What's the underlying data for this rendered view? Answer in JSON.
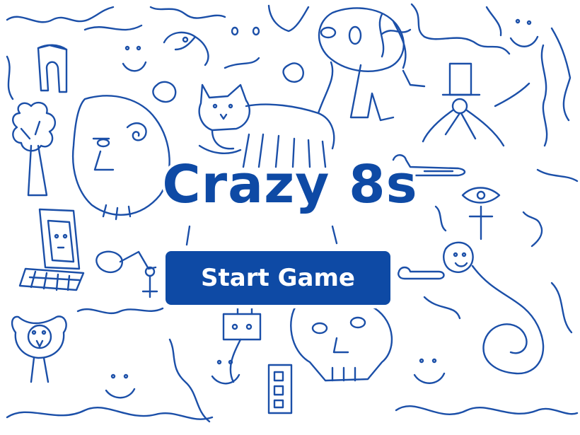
{
  "game": {
    "title": "Crazy 8s",
    "start_label": "Start Game"
  },
  "colors": {
    "ink": "#1b4fa8",
    "title": "#0e4aa5",
    "button": "#0e4aa5",
    "button_text": "#ffffff",
    "background": "#ffffff"
  },
  "background_art": {
    "style": "hand-drawn blue doodles",
    "doodles": [
      "face-ghost",
      "cat",
      "skeleton-dog",
      "alien-head",
      "top-hat-creature",
      "tree",
      "arch-portal",
      "old-computer",
      "robot-arm",
      "owl",
      "smiling-blob",
      "robot-head",
      "skull",
      "snail",
      "eye-sigil",
      "paint-brush",
      "safety-pin",
      "bird-head",
      "smiley-face"
    ]
  }
}
